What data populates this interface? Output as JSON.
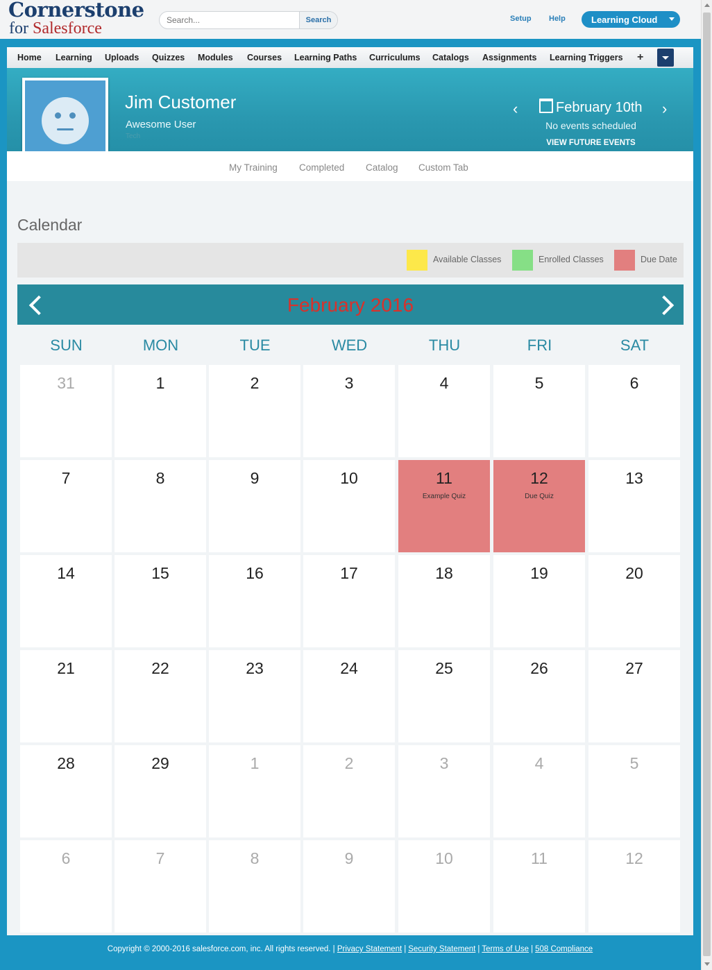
{
  "brand": {
    "line1": "Cornerstone",
    "line2_for": "for",
    "line2_name": "Salesforce"
  },
  "search": {
    "placeholder": "Search...",
    "button": "Search"
  },
  "toplinks": {
    "setup": "Setup",
    "help": "Help",
    "app_menu": "Learning Cloud"
  },
  "nav": {
    "items": [
      "Home",
      "Learning",
      "Uploads",
      "Quizzes",
      "Modules",
      "Courses",
      "Learning Paths",
      "Curriculums",
      "Catalogs",
      "Assignments",
      "Learning Triggers"
    ],
    "plus": "+"
  },
  "profile": {
    "name": "Jim Customer",
    "role": "Awesome User",
    "dept": "Tech"
  },
  "events": {
    "date": "February 10th",
    "status": "No events scheduled",
    "link": "VIEW FUTURE EVENTS"
  },
  "subnav": [
    "My Training",
    "Completed",
    "Catalog",
    "Custom Tab"
  ],
  "calendar": {
    "title": "Calendar",
    "legend": [
      {
        "label": "Available Classes",
        "color": "#fde84a"
      },
      {
        "label": "Enrolled Classes",
        "color": "#86df86"
      },
      {
        "label": "Due Date",
        "color": "#e27f7f"
      }
    ],
    "month": "February 2016",
    "weekdays": [
      "SUN",
      "MON",
      "TUE",
      "WED",
      "THU",
      "FRI",
      "SAT"
    ],
    "weeks": [
      [
        {
          "d": "31",
          "m": true
        },
        {
          "d": "1"
        },
        {
          "d": "2"
        },
        {
          "d": "3"
        },
        {
          "d": "4"
        },
        {
          "d": "5"
        },
        {
          "d": "6"
        }
      ],
      [
        {
          "d": "7"
        },
        {
          "d": "8"
        },
        {
          "d": "9"
        },
        {
          "d": "10"
        },
        {
          "d": "11",
          "event": "Example Quiz",
          "due": true
        },
        {
          "d": "12",
          "event": "Due Quiz",
          "due": true
        },
        {
          "d": "13"
        }
      ],
      [
        {
          "d": "14"
        },
        {
          "d": "15"
        },
        {
          "d": "16"
        },
        {
          "d": "17"
        },
        {
          "d": "18"
        },
        {
          "d": "19"
        },
        {
          "d": "20"
        }
      ],
      [
        {
          "d": "21"
        },
        {
          "d": "22"
        },
        {
          "d": "23"
        },
        {
          "d": "24"
        },
        {
          "d": "25"
        },
        {
          "d": "26"
        },
        {
          "d": "27"
        }
      ],
      [
        {
          "d": "28"
        },
        {
          "d": "29"
        },
        {
          "d": "1",
          "m": true
        },
        {
          "d": "2",
          "m": true
        },
        {
          "d": "3",
          "m": true
        },
        {
          "d": "4",
          "m": true
        },
        {
          "d": "5",
          "m": true
        }
      ],
      [
        {
          "d": "6",
          "m": true
        },
        {
          "d": "7",
          "m": true
        },
        {
          "d": "8",
          "m": true
        },
        {
          "d": "9",
          "m": true
        },
        {
          "d": "10",
          "m": true
        },
        {
          "d": "11",
          "m": true
        },
        {
          "d": "12",
          "m": true
        }
      ]
    ]
  },
  "footer": {
    "copyright": "Copyright © 2000-2016 salesforce.com, inc. All rights reserved. |",
    "links": [
      "Privacy Statement",
      "Security Statement",
      "Terms of Use",
      "508 Compliance"
    ]
  },
  "colors": {
    "accent": "#1b95c3",
    "banner": "#2a98b0",
    "month_bar": "#278a9c",
    "due": "#e27f7f"
  }
}
